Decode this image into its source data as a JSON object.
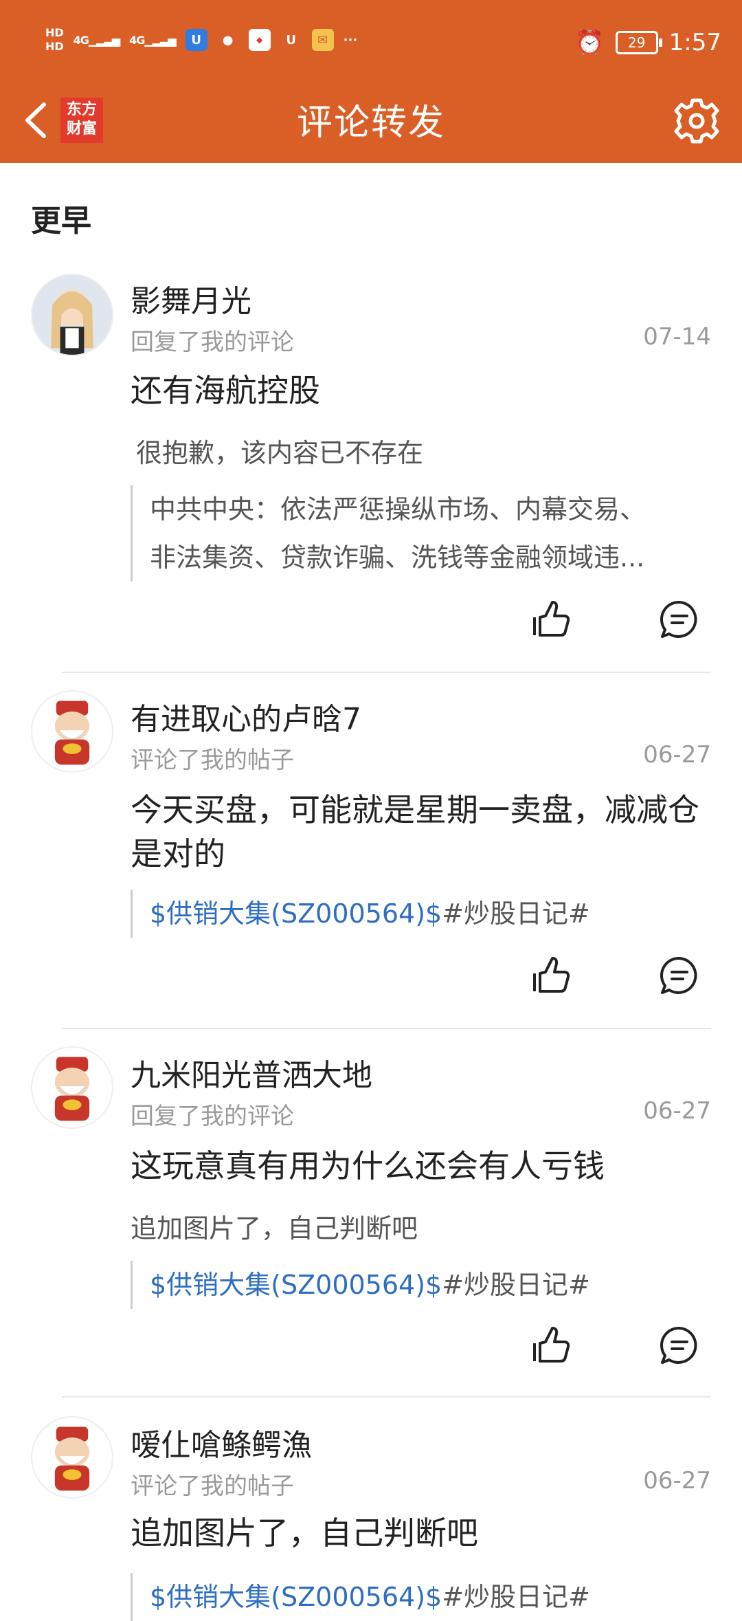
{
  "status_bar": {
    "hd1": "HD",
    "hd2": "HD",
    "net1": "4G",
    "net2": "4G",
    "more": "···",
    "battery": "29",
    "time": "1:57"
  },
  "header": {
    "logo_line1": "东方",
    "logo_line2": "财富",
    "title": "评论转发"
  },
  "section_title": "更早",
  "items": [
    {
      "username": "影舞月光",
      "action": "回复了我的评论",
      "date": "07-14",
      "comment": "还有海航控股",
      "subtext": "很抱歉，该内容已不存在",
      "quote_line1": "中共中央：依法严惩操纵市场、内幕交易、",
      "quote_line2": "非法集资、贷款诈骗、洗钱等金融领域违..."
    },
    {
      "username": "有进取心的卢晗7",
      "action": "评论了我的帖子",
      "date": "06-27",
      "comment": "今天买盘，可能就是星期一卖盘，减减仓是对的",
      "quote_link": "$供销大集(SZ000564)$",
      "quote_tag": "#炒股日记#"
    },
    {
      "username": "九米阳光普洒大地",
      "action": "回复了我的评论",
      "date": "06-27",
      "comment": "这玩意真有用为什么还会有人亏钱",
      "subtext": "追加图片了，自己判断吧",
      "quote_link": "$供销大集(SZ000564)$",
      "quote_tag": "#炒股日记#"
    },
    {
      "username": "嗳仩嗆鲦鳄漁",
      "action": "评论了我的帖子",
      "date": "06-27",
      "comment": "追加图片了，自己判断吧",
      "quote_link": "$供销大集(SZ000564)$",
      "quote_tag": "#炒股日记#"
    }
  ],
  "colors": {
    "brand": "#d95f27",
    "link": "#2e6ec2",
    "muted": "#9a9a9a"
  }
}
